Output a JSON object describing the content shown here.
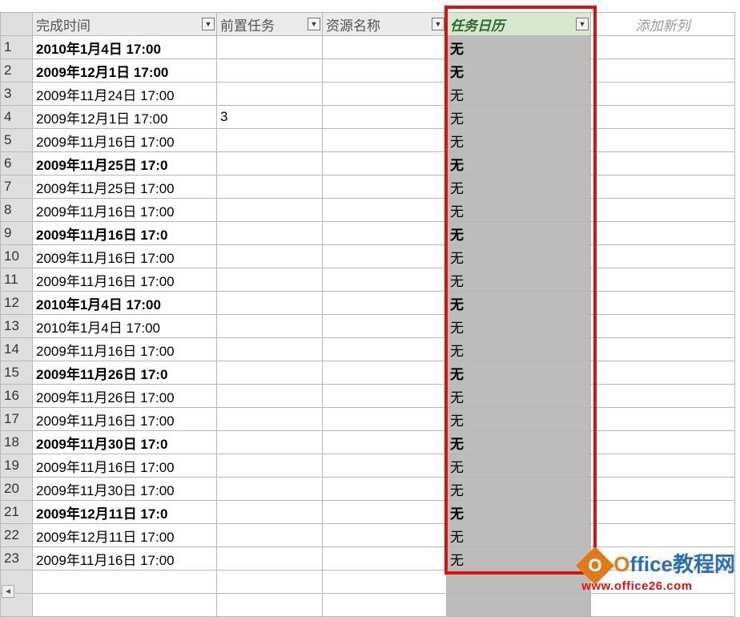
{
  "columns": {
    "finish": "完成时间",
    "predecessor": "前置任务",
    "resource": "资源名称",
    "calendar": "任务日历",
    "addnew": "添加新列"
  },
  "rows": [
    {
      "n": "1",
      "finish": "2010年1月4日 17:00",
      "pred": "",
      "res": "",
      "cal": "无",
      "bold": true
    },
    {
      "n": "2",
      "finish": "2009年12月1日 17:00",
      "pred": "",
      "res": "",
      "cal": "无",
      "bold": true
    },
    {
      "n": "3",
      "finish": "2009年11月24日 17:00",
      "pred": "",
      "res": "",
      "cal": "无",
      "bold": false
    },
    {
      "n": "4",
      "finish": "2009年12月1日 17:00",
      "pred": "3",
      "res": "",
      "cal": "无",
      "bold": false
    },
    {
      "n": "5",
      "finish": "2009年11月16日 17:00",
      "pred": "",
      "res": "",
      "cal": "无",
      "bold": false
    },
    {
      "n": "6",
      "finish": "2009年11月25日 17:0",
      "pred": "",
      "res": "",
      "cal": "无",
      "bold": true
    },
    {
      "n": "7",
      "finish": "2009年11月25日 17:00",
      "pred": "",
      "res": "",
      "cal": "无",
      "bold": false
    },
    {
      "n": "8",
      "finish": "2009年11月16日 17:00",
      "pred": "",
      "res": "",
      "cal": "无",
      "bold": false
    },
    {
      "n": "9",
      "finish": "2009年11月16日 17:0",
      "pred": "",
      "res": "",
      "cal": "无",
      "bold": true
    },
    {
      "n": "10",
      "finish": "2009年11月16日 17:00",
      "pred": "",
      "res": "",
      "cal": "无",
      "bold": false
    },
    {
      "n": "11",
      "finish": "2009年11月16日 17:00",
      "pred": "",
      "res": "",
      "cal": "无",
      "bold": false
    },
    {
      "n": "12",
      "finish": "2010年1月4日 17:00",
      "pred": "",
      "res": "",
      "cal": "无",
      "bold": true
    },
    {
      "n": "13",
      "finish": "2010年1月4日 17:00",
      "pred": "",
      "res": "",
      "cal": "无",
      "bold": false
    },
    {
      "n": "14",
      "finish": "2009年11月16日 17:00",
      "pred": "",
      "res": "",
      "cal": "无",
      "bold": false
    },
    {
      "n": "15",
      "finish": "2009年11月26日 17:0",
      "pred": "",
      "res": "",
      "cal": "无",
      "bold": true
    },
    {
      "n": "16",
      "finish": "2009年11月26日 17:00",
      "pred": "",
      "res": "",
      "cal": "无",
      "bold": false
    },
    {
      "n": "17",
      "finish": "2009年11月16日 17:00",
      "pred": "",
      "res": "",
      "cal": "无",
      "bold": false
    },
    {
      "n": "18",
      "finish": "2009年11月30日 17:0",
      "pred": "",
      "res": "",
      "cal": "无",
      "bold": true
    },
    {
      "n": "19",
      "finish": "2009年11月16日 17:00",
      "pred": "",
      "res": "",
      "cal": "无",
      "bold": false
    },
    {
      "n": "20",
      "finish": "2009年11月30日 17:00",
      "pred": "",
      "res": "",
      "cal": "无",
      "bold": false
    },
    {
      "n": "21",
      "finish": "2009年12月11日 17:0",
      "pred": "",
      "res": "",
      "cal": "无",
      "bold": true
    },
    {
      "n": "22",
      "finish": "2009年12月11日 17:00",
      "pred": "",
      "res": "",
      "cal": "无",
      "bold": false
    },
    {
      "n": "23",
      "finish": "2009年11月16日 17:00",
      "pred": "",
      "res": "",
      "cal": "无",
      "bold": false
    }
  ],
  "watermark": {
    "brand_o": "O",
    "brand_rest": "ffice教程网",
    "url": "www.office26.com"
  },
  "icons": {
    "dropdown": "▼",
    "scroll_left": "◄"
  }
}
